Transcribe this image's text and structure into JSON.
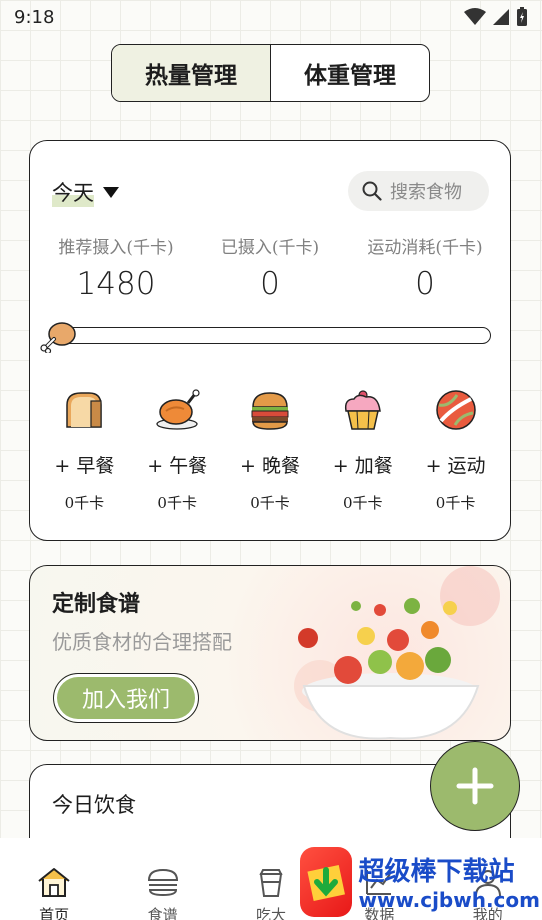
{
  "status_bar": {
    "time": "9:18"
  },
  "segmented": {
    "tabs": [
      {
        "label": "热量管理",
        "active": true
      },
      {
        "label": "体重管理",
        "active": false
      }
    ]
  },
  "summary": {
    "date_selector": "今天",
    "search_placeholder": "搜索食物",
    "stats": [
      {
        "label": "推荐摄入(千卡)",
        "value": "1480"
      },
      {
        "label": "已摄入(千卡)",
        "value": "0"
      },
      {
        "label": "运动消耗(千卡)",
        "value": "0"
      }
    ],
    "progress": 0,
    "meals": [
      {
        "label": "+ 早餐",
        "kcal": "0千卡",
        "icon": "toast-icon"
      },
      {
        "label": "+ 午餐",
        "kcal": "0千卡",
        "icon": "roast-chicken-icon"
      },
      {
        "label": "+ 晚餐",
        "kcal": "0千卡",
        "icon": "burger-icon"
      },
      {
        "label": "+ 加餐",
        "kcal": "0千卡",
        "icon": "cupcake-icon"
      },
      {
        "label": "+ 运动",
        "kcal": "0千卡",
        "icon": "ball-icon"
      }
    ]
  },
  "banner": {
    "title": "定制食谱",
    "subtitle": "优质食材的合理搭配",
    "button": "加入我们"
  },
  "today_diet": {
    "title": "今日饮食"
  },
  "bottom_nav": [
    {
      "label": "首页",
      "icon": "home-icon",
      "active": true
    },
    {
      "label": "食谱",
      "icon": "burger-outline-icon"
    },
    {
      "label": "吃大",
      "icon": "cup-icon"
    },
    {
      "label": "数据",
      "icon": "chart-icon"
    },
    {
      "label": "我的",
      "icon": "user-icon"
    }
  ],
  "watermark": {
    "title": "超级棒下载站",
    "url": "www.cjbwh.com"
  },
  "colors": {
    "accent": "#9cba6d",
    "accent_light": "#eff1e2"
  }
}
